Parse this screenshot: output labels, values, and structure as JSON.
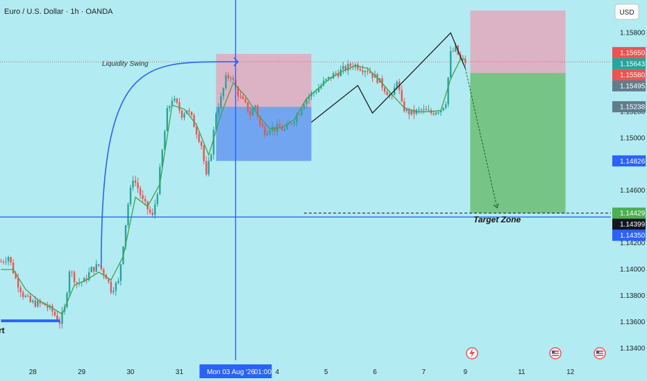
{
  "header": {
    "title": "Euro / U.S. Dollar · 1h · OANDA",
    "currency_button": "USD"
  },
  "annotations": {
    "liquidity_swing": "Liquidity Swing",
    "target_zone": "Target Zone",
    "partial_label": "rt"
  },
  "crosshair": {
    "date_label": "Mon 03 Aug '26",
    "time_label": "01:00"
  },
  "colors": {
    "background": "#b2ebf2",
    "up": "#26a69a",
    "down": "#ef5350",
    "blue_line": "#2962ff",
    "sma": "#43a047",
    "stop_zone": "#e8a0b4",
    "target_fill": "#66bb6a"
  },
  "chart_data": {
    "type": "candlestick",
    "title": "Euro / U.S. Dollar · 1h · OANDA",
    "y_axis": {
      "ticks": [
        1.158,
        1.154,
        1.152,
        1.15,
        1.146,
        1.142,
        1.14,
        1.138,
        1.136,
        1.134
      ],
      "tick_labels": [
        "1.15800",
        "1.15400",
        "1.15200",
        "1.15000",
        "1.14600",
        "1.14200",
        "1.14000",
        "1.13800",
        "1.13600",
        "1.13400"
      ],
      "ylim": [
        1.1331,
        1.1605
      ]
    },
    "x_axis": {
      "ticks": [
        {
          "label": "28",
          "i": 13
        },
        {
          "label": "29",
          "i": 33
        },
        {
          "label": "30",
          "i": 53
        },
        {
          "label": "31",
          "i": 73
        },
        {
          "label": "4",
          "i": 113
        },
        {
          "label": "5",
          "i": 133
        },
        {
          "label": "6",
          "i": 153
        },
        {
          "label": "7",
          "i": 173
        },
        {
          "label": "9",
          "i": 190
        },
        {
          "label": "11",
          "i": 213
        },
        {
          "label": "12",
          "i": 233
        }
      ],
      "crosshair_i": 96,
      "last_i": 250
    },
    "price_badges": [
      {
        "label": "1.15650",
        "value": 1.1565,
        "color": "#ef5350"
      },
      {
        "label": "1.15643",
        "value": 1.15643,
        "color": "#26a69a"
      },
      {
        "label": "1.15580",
        "value": 1.1558,
        "color": "#ef5350"
      },
      {
        "label": "1.15495",
        "value": 1.15495,
        "color": "#607d8b"
      },
      {
        "label": "1.15238",
        "value": 1.15238,
        "color": "#607d8b"
      },
      {
        "label": "1.14826",
        "value": 1.14826,
        "color": "#2962ff"
      },
      {
        "label": "1.14429",
        "value": 1.14429,
        "color": "#4caf50"
      },
      {
        "label": "1.14399",
        "value": 1.14399,
        "color": "#131722"
      },
      {
        "label": "1.14350",
        "value": 1.1435,
        "color": "#2962ff"
      }
    ],
    "waypoints": [
      [
        0,
        1.1406
      ],
      [
        3,
        1.141
      ],
      [
        6,
        1.1393
      ],
      [
        9,
        1.1381
      ],
      [
        12,
        1.1375
      ],
      [
        15,
        1.1374
      ],
      [
        18,
        1.1373
      ],
      [
        21,
        1.1368
      ],
      [
        24,
        1.136
      ],
      [
        26,
        1.137
      ],
      [
        28,
        1.14
      ],
      [
        31,
        1.139
      ],
      [
        34,
        1.1391
      ],
      [
        37,
        1.14
      ],
      [
        40,
        1.1403
      ],
      [
        43,
        1.1395
      ],
      [
        45,
        1.1385
      ],
      [
        48,
        1.139
      ],
      [
        50,
        1.142
      ],
      [
        52,
        1.145
      ],
      [
        54,
        1.147
      ],
      [
        56,
        1.1462
      ],
      [
        58,
        1.1452
      ],
      [
        60,
        1.1446
      ],
      [
        62,
        1.144
      ],
      [
        64,
        1.146
      ],
      [
        66,
        1.149
      ],
      [
        68,
        1.152
      ],
      [
        70,
        1.153
      ],
      [
        72,
        1.1525
      ],
      [
        74,
        1.1518
      ],
      [
        76,
        1.1522
      ],
      [
        78,
        1.1515
      ],
      [
        80,
        1.1505
      ],
      [
        82,
        1.1495
      ],
      [
        84,
        1.147
      ],
      [
        86,
        1.149
      ],
      [
        88,
        1.152
      ],
      [
        90,
        1.153
      ],
      [
        92,
        1.1545
      ],
      [
        94,
        1.1548
      ],
      [
        96,
        1.1538
      ],
      [
        98,
        1.153
      ],
      [
        100,
        1.1525
      ],
      [
        102,
        1.1518
      ],
      [
        104,
        1.1525
      ],
      [
        106,
        1.151
      ],
      [
        108,
        1.1505
      ],
      [
        110,
        1.1508
      ],
      [
        112,
        1.1507
      ],
      [
        114,
        1.1508
      ],
      [
        116,
        1.1506
      ],
      [
        118,
        1.151
      ],
      [
        120,
        1.1515
      ],
      [
        122,
        1.152
      ],
      [
        124,
        1.1528
      ],
      [
        126,
        1.1532
      ],
      [
        128,
        1.1535
      ],
      [
        130,
        1.1538
      ],
      [
        132,
        1.1542
      ],
      [
        134,
        1.1545
      ],
      [
        136,
        1.1548
      ],
      [
        138,
        1.155
      ],
      [
        140,
        1.1552
      ],
      [
        142,
        1.1554
      ],
      [
        144,
        1.1556
      ],
      [
        146,
        1.1555
      ],
      [
        148,
        1.1553
      ],
      [
        150,
        1.1552
      ],
      [
        152,
        1.1548
      ],
      [
        154,
        1.1545
      ],
      [
        156,
        1.154
      ],
      [
        158,
        1.1535
      ],
      [
        160,
        1.153
      ],
      [
        162,
        1.1545
      ],
      [
        163,
        1.1535
      ],
      [
        164,
        1.1525
      ],
      [
        166,
        1.152
      ],
      [
        168,
        1.1519
      ],
      [
        170,
        1.152
      ],
      [
        172,
        1.1521
      ],
      [
        174,
        1.152
      ],
      [
        176,
        1.1519
      ],
      [
        178,
        1.1521
      ],
      [
        180,
        1.1522
      ],
      [
        182,
        1.1528
      ],
      [
        184,
        1.1564
      ],
      [
        186,
        1.1568
      ],
      [
        188,
        1.1559
      ],
      [
        190,
        1.1558
      ]
    ],
    "sma_waypoints": [
      [
        0,
        1.14
      ],
      [
        5,
        1.14
      ],
      [
        10,
        1.1385
      ],
      [
        15,
        1.1377
      ],
      [
        20,
        1.1372
      ],
      [
        25,
        1.1366
      ],
      [
        30,
        1.1388
      ],
      [
        35,
        1.1392
      ],
      [
        40,
        1.1398
      ],
      [
        45,
        1.1392
      ],
      [
        50,
        1.141
      ],
      [
        55,
        1.1455
      ],
      [
        60,
        1.1448
      ],
      [
        65,
        1.1465
      ],
      [
        70,
        1.1525
      ],
      [
        75,
        1.1522
      ],
      [
        80,
        1.151
      ],
      [
        85,
        1.1487
      ],
      [
        90,
        1.1518
      ],
      [
        95,
        1.1542
      ],
      [
        100,
        1.1532
      ],
      [
        105,
        1.1518
      ],
      [
        110,
        1.1507
      ],
      [
        115,
        1.1508
      ],
      [
        120,
        1.1514
      ],
      [
        125,
        1.153
      ],
      [
        130,
        1.1538
      ],
      [
        135,
        1.1546
      ],
      [
        140,
        1.1551
      ],
      [
        145,
        1.1555
      ],
      [
        150,
        1.1553
      ],
      [
        155,
        1.1544
      ],
      [
        160,
        1.1533
      ],
      [
        165,
        1.1523
      ],
      [
        170,
        1.152
      ],
      [
        175,
        1.152
      ],
      [
        180,
        1.1521
      ],
      [
        184,
        1.1545
      ],
      [
        188,
        1.156
      ],
      [
        190,
        1.156
      ]
    ],
    "zones": {
      "left_stop": {
        "i0": 88,
        "i1": 127,
        "top": 1.1564,
        "bottom": 1.15238
      },
      "left_target": {
        "i0": 88,
        "i1": 127,
        "top": 1.15238,
        "bottom": 1.14826
      },
      "right_stop": {
        "i0": 192,
        "i1": 231,
        "top": 1.1597,
        "bottom": 1.15495
      },
      "right_target": {
        "i0": 192,
        "i1": 231,
        "top": 1.15495,
        "bottom": 1.14429
      }
    },
    "liquidity_level": 1.1558,
    "target_level": 1.14429,
    "support_level": 1.14399,
    "zigzag": [
      [
        127,
        1.1512
      ],
      [
        146,
        1.154
      ],
      [
        152,
        1.1519
      ],
      [
        184,
        1.158
      ],
      [
        190,
        1.1553
      ]
    ],
    "arrow_projection": [
      [
        190,
        1.1553
      ],
      [
        203,
        1.1447
      ]
    ],
    "liquidity_arc": {
      "from": [
        41,
        1.1402
      ],
      "to": [
        97,
        1.1558
      ]
    },
    "left_support": {
      "i0": 0,
      "i1": 24,
      "value": 1.1361
    }
  }
}
